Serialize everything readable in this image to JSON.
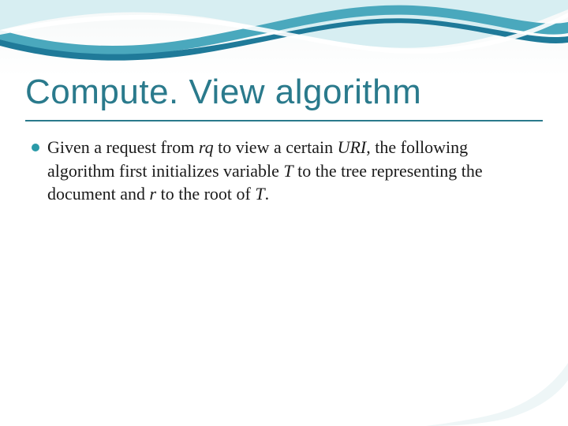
{
  "slide": {
    "title": "Compute. View algorithm",
    "bullets": [
      {
        "segments": [
          {
            "text": "Given a request from ",
            "italic": false
          },
          {
            "text": "rq",
            "italic": true
          },
          {
            "text": " to view a certain ",
            "italic": false
          },
          {
            "text": "URI",
            "italic": true
          },
          {
            "text": ", the following algorithm first initializes variable ",
            "italic": false
          },
          {
            "text": "T",
            "italic": true
          },
          {
            "text": " to the tree representing the document and ",
            "italic": false
          },
          {
            "text": "r",
            "italic": true
          },
          {
            "text": " to the root of ",
            "italic": false
          },
          {
            "text": "T",
            "italic": true
          },
          {
            "text": ".",
            "italic": false
          }
        ]
      }
    ]
  },
  "theme": {
    "accent": "#2a7a8c",
    "bullet": "#2a9aa8",
    "wave_light": "#bfe6ee",
    "wave_mid": "#5bb5c9",
    "wave_dark": "#1f7a99"
  }
}
